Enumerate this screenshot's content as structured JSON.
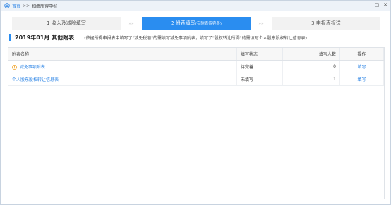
{
  "titlebar": {
    "home": "首页",
    "separator": ">>",
    "current": "扣缴所得申报",
    "controls": [
      "□",
      "✕"
    ]
  },
  "steps": [
    {
      "label": "1 收入及减除填写",
      "sub": "",
      "active": false
    },
    {
      "label": "2 附表填写",
      "sub": "(有附表待完善)",
      "active": true
    },
    {
      "label": "3 申报表报送",
      "sub": "",
      "active": false
    }
  ],
  "step_arrow": "»»",
  "heading": {
    "title": "2019年01月  其他附表",
    "note": "(依据所得申报表中填写了\"减免税额\"的需填写减免事项附表，填写了\"股权转让所得\"的需填写个人股东股权转让信息表)"
  },
  "table": {
    "headers": [
      "附表名称",
      "填写状态",
      "填写人数",
      "操作"
    ],
    "rows": [
      {
        "name": "减免事项附表",
        "status": "待完善",
        "count": "0",
        "action": "填写",
        "warn": true
      },
      {
        "name": "个人股东股权转让信息表",
        "status": "未填写",
        "count": "1",
        "action": "填写",
        "warn": false
      }
    ]
  },
  "colors": {
    "accent": "#2a8df0",
    "link": "#2a83e5",
    "warn": "#f0a020"
  }
}
